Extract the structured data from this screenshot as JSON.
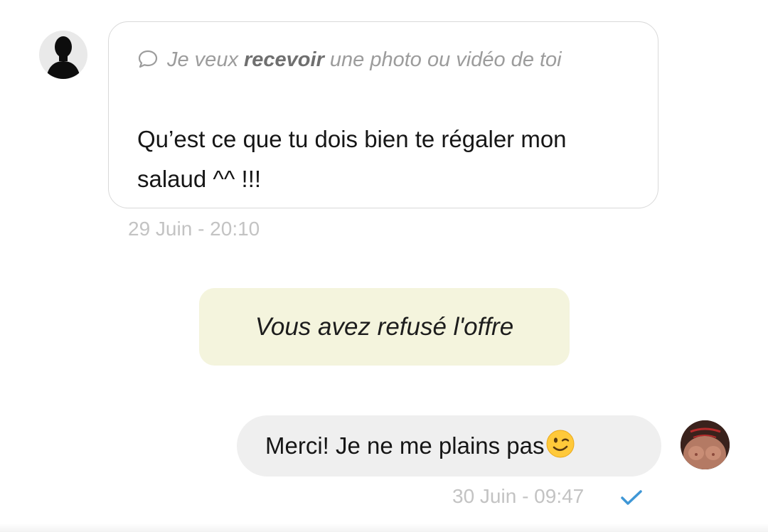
{
  "conversation": {
    "incoming": {
      "avatar_icon": "user-silhouette-icon",
      "request_icon": "chat-bubble-icon",
      "request_prefix": "Je veux ",
      "request_action": "recevoir",
      "request_suffix": " une photo ou vidéo de toi",
      "text": "Qu’est ce que tu dois bien te régaler mon salaud ^^ !!!",
      "timestamp": "29 Juin - 20:10"
    },
    "system": {
      "text": "Vous avez refusé l'offre",
      "background_color": "#f4f4dd"
    },
    "outgoing": {
      "text": "Merci! Je ne me plains pas",
      "emoji_icon": "winking-face-icon",
      "timestamp": "30 Juin - 09:47",
      "status_icon": "read-check-icon",
      "status_color": "#3f97d6",
      "avatar_icon": "profile-photo-icon"
    }
  }
}
